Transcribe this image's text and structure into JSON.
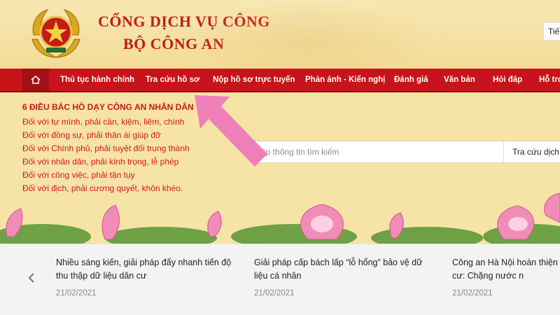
{
  "header": {
    "title_line1": "CỔNG DỊCH VỤ CÔNG",
    "title_line2": "BỘ CÔNG AN",
    "language": "Tiế"
  },
  "nav": {
    "home_icon": "home-icon",
    "items": [
      "Thủ tục hành chính",
      "Tra cứu hồ sơ",
      "Nộp hồ sơ trực tuyến",
      "Phản ánh - Kiến nghị",
      "Đánh giá",
      "Văn bản",
      "Hỏi đáp",
      "Hỗ trợ"
    ]
  },
  "mottos": {
    "heading": "6 ĐIỀU BÁC HỒ DẠY CÔNG AN NHÂN DÂN",
    "lines": [
      "Đối với tự mình, phải cần, kiệm, liêm, chính",
      "Đối với đồng sự, phải thân ái giúp đỡ",
      "Đối với Chính phủ, phải tuyệt đối trung thành",
      "Đối với nhân dân, phải kính trọng, lễ phép",
      "Đối với công việc, phải tận tụy",
      "Đối với địch, phải cương quyết, khôn khéo."
    ]
  },
  "search": {
    "placeholder": "ập thông tin tìm kiếm",
    "button": "Tra cứu dịch"
  },
  "news": [
    {
      "title": "Nhiều sáng kiến, giải pháp đẩy nhanh tiến độ thu thập dữ liệu dân cư",
      "date": "21/02/2021"
    },
    {
      "title": "Giải pháp cấp bách lấp “lỗ hổng” bảo vệ dữ liệu cá nhân",
      "date": "21/02/2021"
    },
    {
      "title": "Công an Hà Nội hoàn thiện gia về dân cư: Chặng nước n",
      "date": "21/02/2021"
    }
  ],
  "colors": {
    "brand_red": "#c8131b",
    "text_red": "#d5171f",
    "arrow_pink": "#ef7fb8",
    "background": "#f6e3a6"
  }
}
